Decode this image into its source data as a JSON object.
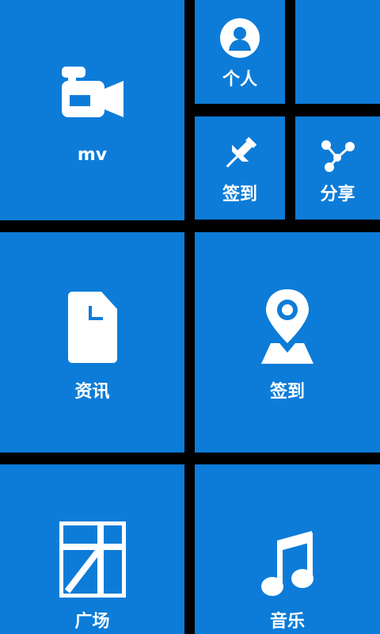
{
  "tiles": {
    "mv": {
      "label": "mv",
      "icon": "video-camera-icon"
    },
    "profile": {
      "label": "个人",
      "icon": "person-icon"
    },
    "blank": {
      "label": "",
      "icon": ""
    },
    "checkin_small": {
      "label": "签到",
      "icon": "pushpin-icon"
    },
    "share": {
      "label": "分享",
      "icon": "share-icon"
    },
    "news": {
      "label": "资讯",
      "icon": "document-icon"
    },
    "checkin_large": {
      "label": "签到",
      "icon": "map-pin-icon"
    },
    "square": {
      "label": "广场",
      "icon": "square-logo-icon"
    },
    "music": {
      "label": "音乐",
      "icon": "music-note-icon"
    }
  },
  "colors": {
    "tile_bg": "#0d7cd8",
    "background": "#000000",
    "foreground": "#ffffff"
  }
}
